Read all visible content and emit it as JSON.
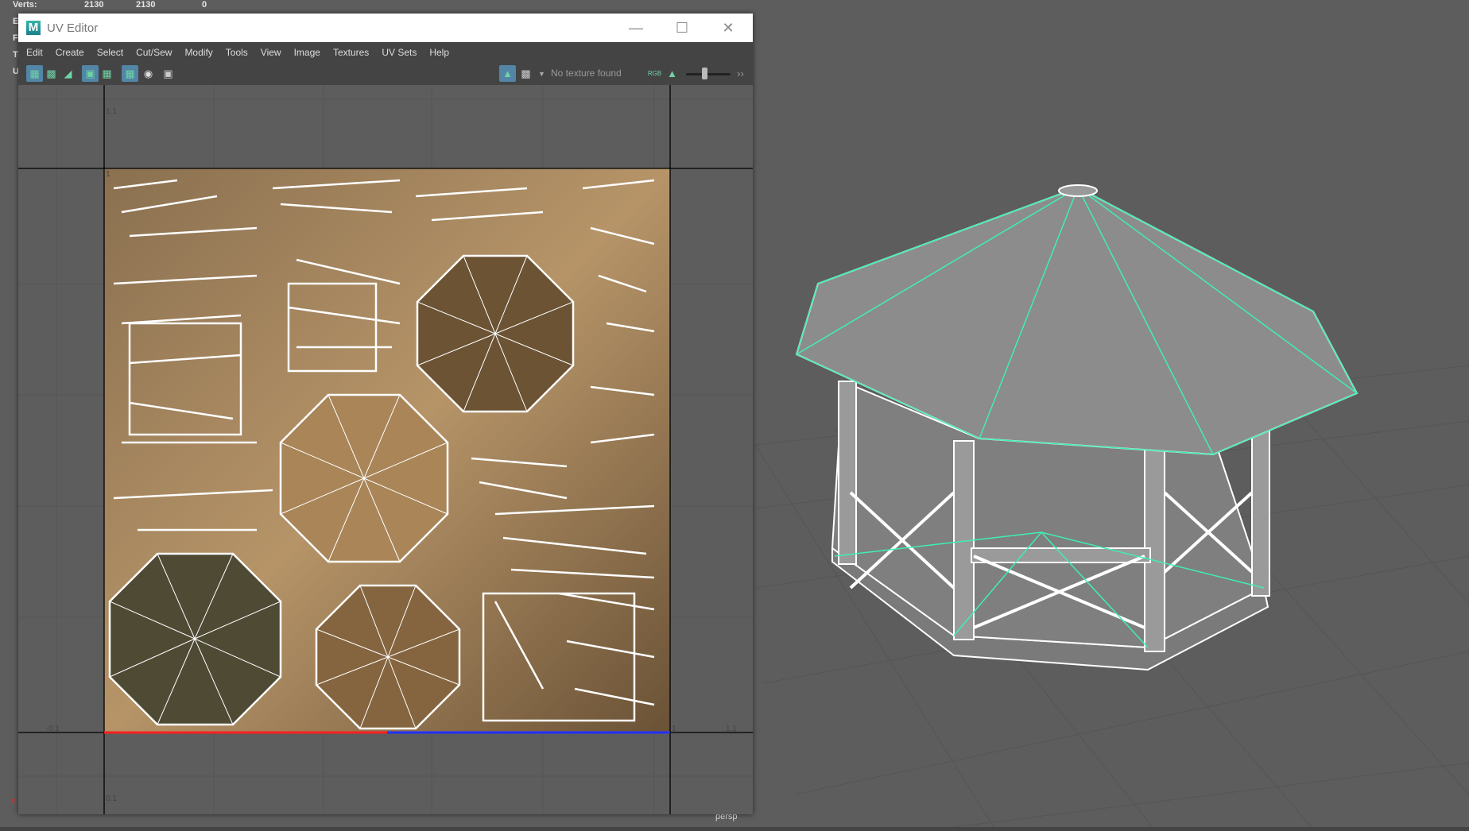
{
  "hud": {
    "rows": [
      {
        "label": "Verts:",
        "a": "2130",
        "b": "2130",
        "c": "0"
      },
      {
        "label": "E"
      },
      {
        "label": "F"
      },
      {
        "label": "Tr"
      },
      {
        "label": "U"
      }
    ]
  },
  "window": {
    "title": "UV Editor",
    "logo": "M"
  },
  "menu": [
    "Edit",
    "Create",
    "Select",
    "Cut/Sew",
    "Modify",
    "Tools",
    "View",
    "Image",
    "Textures",
    "UV Sets",
    "Help"
  ],
  "toolbar": {
    "texture_status": "No texture found",
    "rgb_label": "RGB"
  },
  "uv_axes": {
    "top": "1.1",
    "top_one": "1",
    "left": "-0.1",
    "right": "1.1",
    "bottom_left": "0.1",
    "bottom_one": "1"
  },
  "viewport": {
    "camera": "persp",
    "axis_x": "x"
  },
  "colors": {
    "wire": "#3ef0b0",
    "uv_border_u": "#ff2020",
    "uv_border_v": "#2030ff",
    "accent": "#5285a6"
  }
}
